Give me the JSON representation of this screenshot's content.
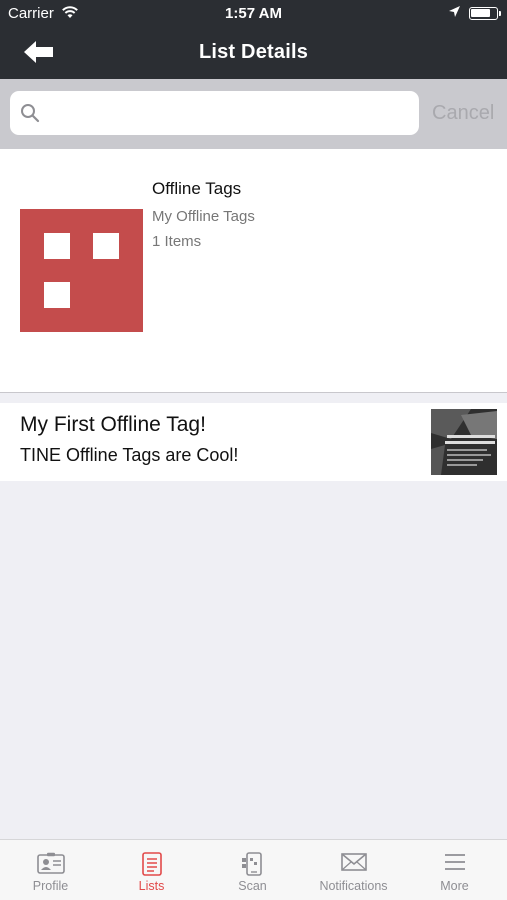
{
  "status_bar": {
    "carrier": "Carrier",
    "time": "1:57 AM"
  },
  "nav": {
    "title": "List Details"
  },
  "search": {
    "placeholder": "",
    "value": "",
    "cancel_label": "Cancel"
  },
  "list": {
    "title": "Offline Tags",
    "subtitle": "My Offline Tags",
    "count": "1 Items",
    "icon_color": "#c44c4c"
  },
  "items": [
    {
      "title": "My First Offline Tag!",
      "description": "TINE Offline Tags are Cool!"
    }
  ],
  "tabs": [
    {
      "label": "Profile",
      "icon": "profile-icon",
      "active": false
    },
    {
      "label": "Lists",
      "icon": "lists-icon",
      "active": true
    },
    {
      "label": "Scan",
      "icon": "scan-icon",
      "active": false
    },
    {
      "label": "Notifications",
      "icon": "envelope-icon",
      "active": false
    },
    {
      "label": "More",
      "icon": "menu-icon",
      "active": false
    }
  ],
  "colors": {
    "nav_bg": "#2b2e33",
    "accent": "#e24a4a",
    "tab_inactive": "#8e8e93"
  }
}
